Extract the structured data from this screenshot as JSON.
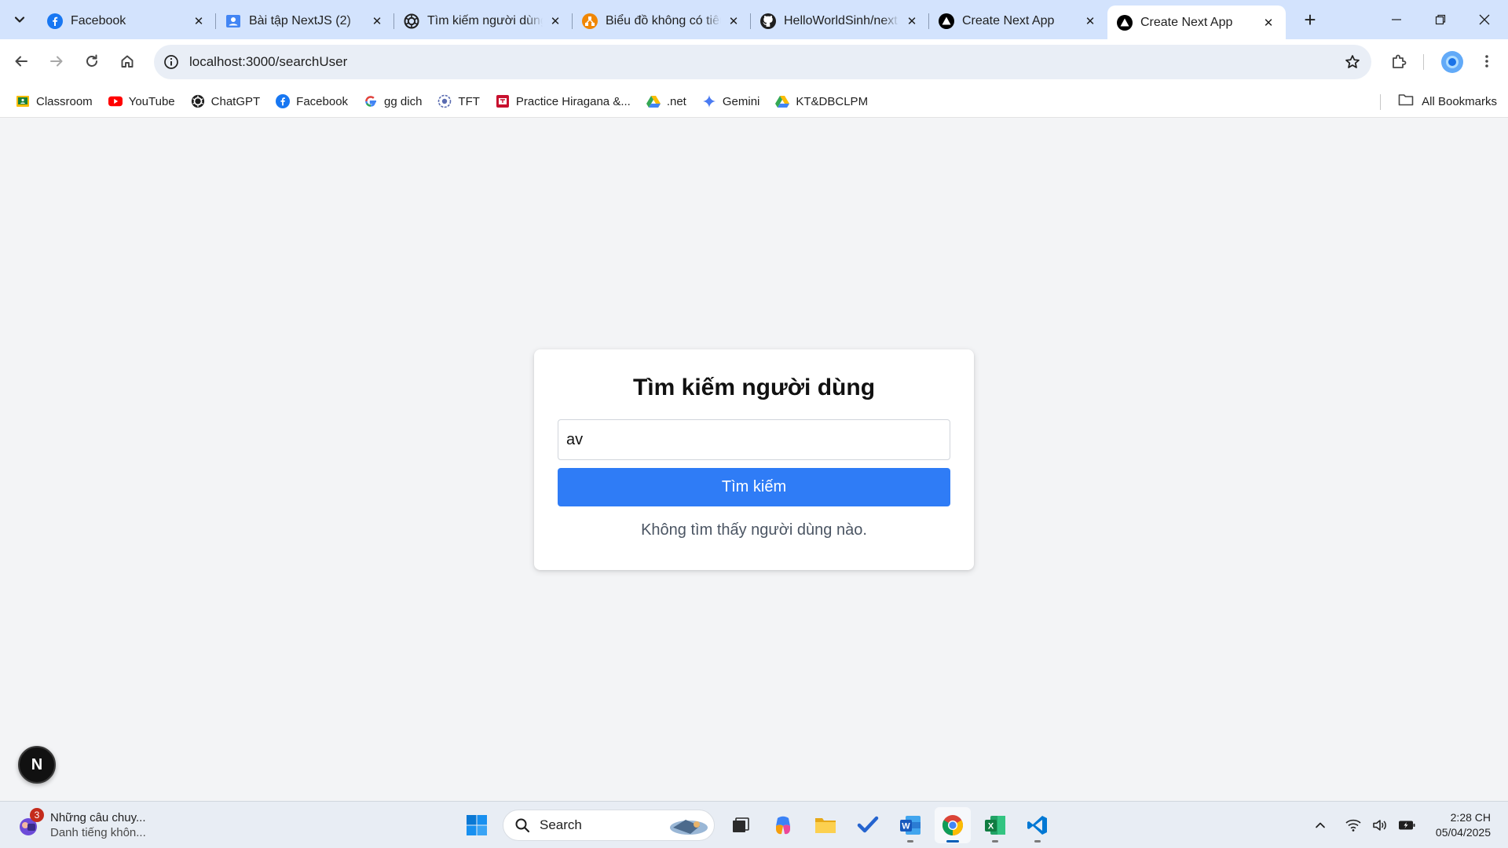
{
  "browser": {
    "tabs": [
      {
        "title": "Facebook",
        "icon": "facebook-icon",
        "active": false
      },
      {
        "title": "Bài tập NextJS (2)",
        "icon": "classroom-assignment-icon",
        "active": false
      },
      {
        "title": "Tìm kiếm người dùng",
        "icon": "chatgpt-icon",
        "active": false
      },
      {
        "title": "Biểu đồ không có tiêu đề",
        "icon": "drawio-icon",
        "active": false
      },
      {
        "title": "HelloWorldSinh/next",
        "icon": "github-icon",
        "active": false
      },
      {
        "title": "Create Next App",
        "icon": "nextjs-icon",
        "active": false
      },
      {
        "title": "Create Next App",
        "icon": "nextjs-icon",
        "active": true
      }
    ],
    "address": "localhost:3000/searchUser",
    "bookmarks": [
      {
        "label": "Classroom",
        "icon": "classroom-icon"
      },
      {
        "label": "YouTube",
        "icon": "youtube-icon"
      },
      {
        "label": "ChatGPT",
        "icon": "chatgpt-icon"
      },
      {
        "label": "Facebook",
        "icon": "facebook-icon"
      },
      {
        "label": "gg dich",
        "icon": "google-icon"
      },
      {
        "label": "TFT",
        "icon": "tft-icon"
      },
      {
        "label": "Practice Hiragana &...",
        "icon": "hiragana-icon"
      },
      {
        "label": ".net",
        "icon": "google-drive-icon"
      },
      {
        "label": "Gemini",
        "icon": "gemini-icon"
      },
      {
        "label": "KT&DBCLPM",
        "icon": "google-drive-icon"
      }
    ],
    "all_bookmarks": "All Bookmarks"
  },
  "page": {
    "heading": "Tìm kiếm người dùng",
    "search_value": "av",
    "search_button": "Tìm kiếm",
    "result_message": "Không tìm thấy người dùng nào.",
    "next_badge": "N"
  },
  "taskbar": {
    "widget": {
      "badge": "3",
      "title": "Những câu chuy...",
      "subtitle": "Danh tiếng khôn..."
    },
    "search_label": "Search",
    "apps": [
      "windows-start-icon",
      "task-view-icon",
      "copilot-icon",
      "file-explorer-icon",
      "todo-icon",
      "word-icon",
      "chrome-icon",
      "excel-icon",
      "vscode-icon"
    ],
    "time": "2:28 CH",
    "date": "05/04/2025"
  },
  "colors": {
    "tabstrip": "#d3e3fd",
    "button": "#2f7cf6",
    "page_bg": "#f3f4f6"
  }
}
